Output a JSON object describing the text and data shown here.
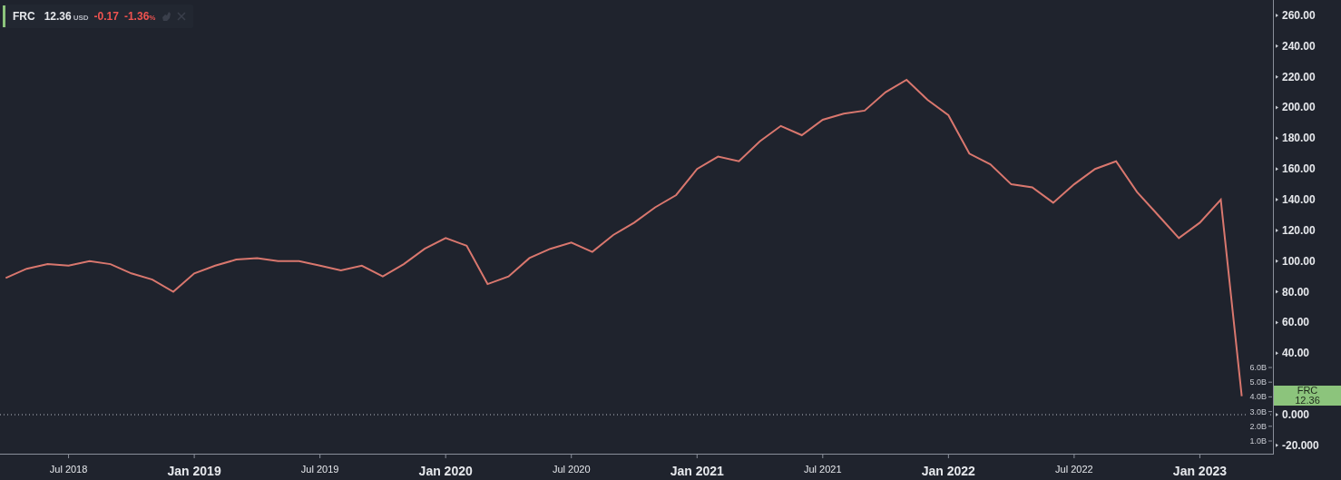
{
  "legend": {
    "symbol": "FRC",
    "price": "12.36",
    "currency": "USD",
    "change": "-0.17",
    "change_percent": "-1.36",
    "percent_sign": "%",
    "negative": true
  },
  "chart": {
    "chart_data": {
      "type": "line",
      "categories": [
        null,
        null,
        null,
        "Jul 2018",
        null,
        null,
        null,
        null,
        null,
        "Jan 2019",
        null,
        null,
        null,
        null,
        null,
        "Jul 2019",
        null,
        null,
        null,
        null,
        null,
        "Jan 2020",
        null,
        null,
        null,
        null,
        null,
        "Jul 2020",
        null,
        null,
        null,
        null,
        null,
        "Jan 2021",
        null,
        null,
        null,
        null,
        null,
        "Jul 2021",
        null,
        null,
        null,
        null,
        null,
        "Jan 2022",
        null,
        null,
        null,
        null,
        null,
        "Jul 2022",
        null,
        null,
        null,
        null,
        null,
        "Jan 2023",
        null,
        null
      ],
      "series": [
        {
          "name": "FRC",
          "color": "#d9776e",
          "values": [
            89,
            95,
            98,
            97,
            100,
            98,
            92,
            88,
            80,
            92,
            97,
            101,
            102,
            100,
            100,
            97,
            94,
            97,
            90,
            98,
            108,
            115,
            110,
            85,
            90,
            102,
            108,
            112,
            106,
            117,
            125,
            135,
            143,
            160,
            168,
            165,
            178,
            188,
            182,
            192,
            196,
            198,
            210,
            218,
            205,
            195,
            170,
            163,
            150,
            148,
            138,
            150,
            160,
            165,
            145,
            130,
            115,
            125,
            140,
            12
          ]
        }
      ],
      "ylim": [
        -25.4,
        270
      ],
      "yticks": [
        {
          "value": 260,
          "label": "260.00"
        },
        {
          "value": 240,
          "label": "240.00"
        },
        {
          "value": 220,
          "label": "220.00"
        },
        {
          "value": 200,
          "label": "200.00"
        },
        {
          "value": 180,
          "label": "180.00"
        },
        {
          "value": 160,
          "label": "160.00"
        },
        {
          "value": 140,
          "label": "140.00"
        },
        {
          "value": 120,
          "label": "120.00"
        },
        {
          "value": 100,
          "label": "100.00"
        },
        {
          "value": 80,
          "label": "80.00"
        },
        {
          "value": 60,
          "label": "60.00"
        },
        {
          "value": 40,
          "label": "40.00"
        },
        {
          "value": 0,
          "label": "0.000"
        },
        {
          "value": -20,
          "label": "-20.000"
        }
      ]
    },
    "date_label_bold": [
      false,
      true,
      false,
      true,
      false,
      true,
      false,
      true,
      false,
      true
    ],
    "volume_scale": [
      "6.0B",
      "5.0B",
      "4.0B",
      "3.0B",
      "2.0B",
      "1.0B"
    ],
    "price_tag": {
      "price": "12.36"
    }
  }
}
